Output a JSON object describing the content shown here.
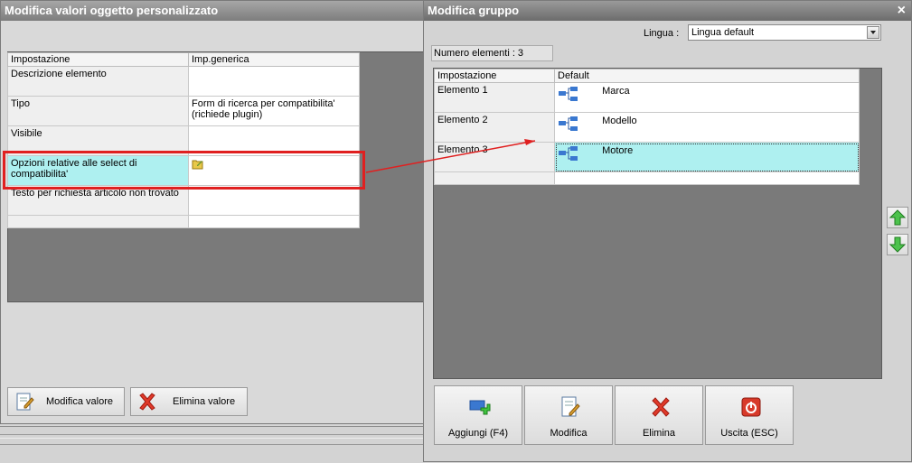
{
  "left_window": {
    "title": "Modifica valori oggetto personalizzato",
    "columns": [
      "Impostazione",
      "Imp.generica"
    ],
    "rows": [
      {
        "label": "Descrizione elemento",
        "value": ""
      },
      {
        "label": "Tipo",
        "value": "Form di ricerca per compatibilita' (richiede plugin)"
      },
      {
        "label": "Visibile",
        "value": ""
      },
      {
        "label": "Opzioni relative alle select di compatibilita'",
        "value": ""
      },
      {
        "label": "Testo per richiesta articolo non trovato",
        "value": ""
      },
      {
        "label": "",
        "value": ""
      }
    ],
    "buttons": {
      "edit": "Modifica valore",
      "delete": "Elimina valore"
    }
  },
  "right_window": {
    "title": "Modifica gruppo",
    "close": "×",
    "language_label": "Lingua :",
    "language_value": "Lingua default",
    "count_label": "Numero elementi : 3",
    "columns": [
      "Impostazione",
      "Default"
    ],
    "rows": [
      {
        "label": "Elemento 1",
        "value": "Marca"
      },
      {
        "label": "Elemento 2",
        "value": "Modello"
      },
      {
        "label": "Elemento 3",
        "value": "Motore"
      },
      {
        "label": "",
        "value": ""
      }
    ],
    "buttons": {
      "add": "Aggiungi (F4)",
      "edit": "Modifica",
      "delete": "Elimina",
      "exit": "Uscita (ESC)"
    }
  },
  "colors": {
    "selection": "#aef0f0",
    "annotation": "#e02020"
  }
}
